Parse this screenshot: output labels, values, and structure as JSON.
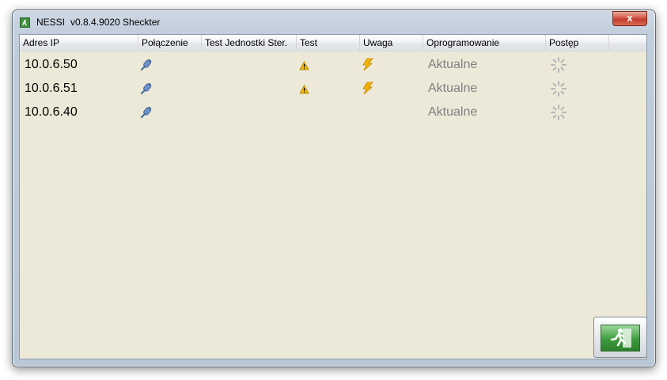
{
  "window": {
    "app_name": "NESSI",
    "version": "v0.8.4.9020 Sheckter",
    "close_label": "x"
  },
  "grid": {
    "columns": [
      "Adres IP",
      "Połączenie",
      "Test Jednostki Ster.",
      "Test",
      "Uwaga",
      "Oprogramowanie",
      "Postęp"
    ],
    "rows": [
      {
        "ip": "10.0.6.50",
        "connection_icon": "plug-icon",
        "test_icon": "warning-icon",
        "alert_icon": "lightning-icon",
        "software": "Aktualne",
        "progress_icon": "spinner-icon"
      },
      {
        "ip": "10.0.6.51",
        "connection_icon": "plug-icon",
        "test_icon": "warning-icon",
        "alert_icon": "lightning-icon",
        "software": "Aktualne",
        "progress_icon": "spinner-icon"
      },
      {
        "ip": "10.0.6.40",
        "connection_icon": "plug-icon",
        "test_icon": "",
        "alert_icon": "",
        "software": "Aktualne",
        "progress_icon": "spinner-icon"
      }
    ]
  },
  "footer": {
    "exit_icon": "exit-running-man-icon"
  },
  "colors": {
    "client_bg": "#ece9d8",
    "status_text": "#808080",
    "warning": "#f2b600",
    "lightning": "#f5b400",
    "exit_green": "#3d9c3d"
  }
}
